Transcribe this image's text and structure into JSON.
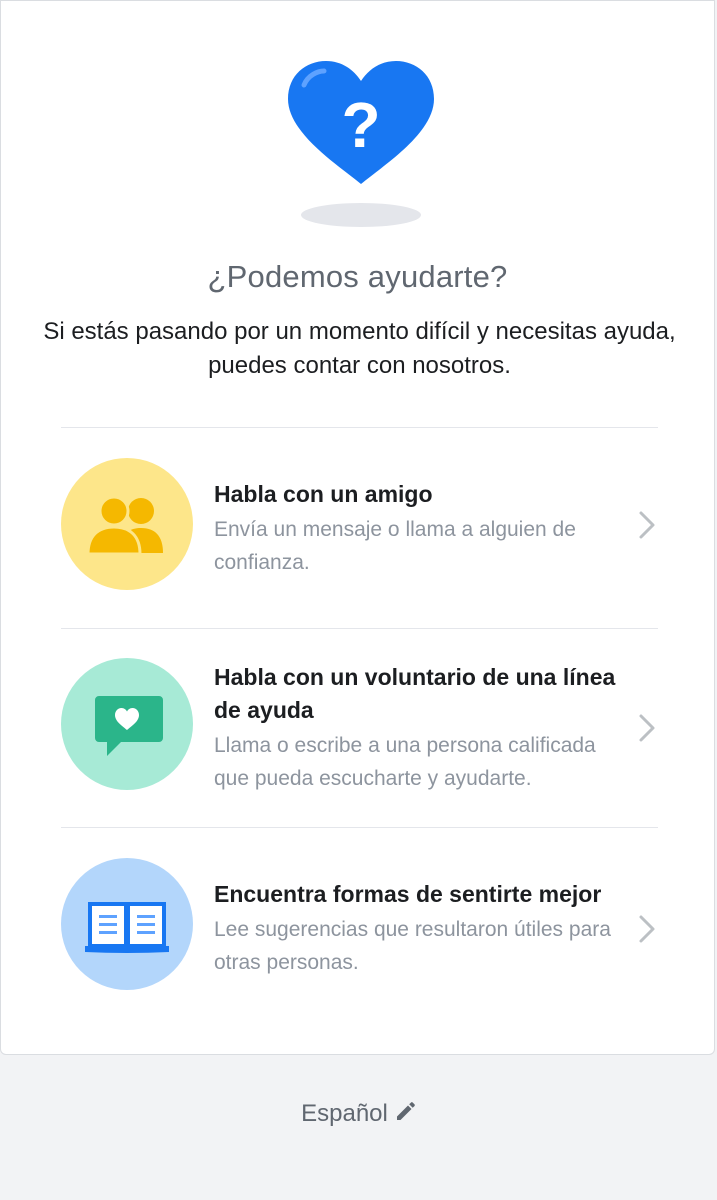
{
  "header": {
    "title": "¿Podemos ayudarte?",
    "subtitle": "Si estás pasando por un momento difícil y necesitas ayuda, puedes contar con nosotros."
  },
  "hero_icon": "heart-question-icon",
  "options": [
    {
      "title": "Habla con un amigo",
      "description": "Envía un mensaje o llama a alguien de confianza.",
      "icon": "people-icon",
      "color": "#fde68a"
    },
    {
      "title": "Habla con un voluntario de una línea de ayuda",
      "description": "Llama o escribe a una persona calificada que pueda escucharte y ayudarte.",
      "icon": "chat-heart-icon",
      "color": "#a7ead6"
    },
    {
      "title": "Encuentra formas de sentirte mejor",
      "description": "Lee sugerencias que resultaron útiles para otras personas.",
      "icon": "book-icon",
      "color": "#b3d6fb"
    }
  ],
  "footer": {
    "language": "Español",
    "edit_icon": "pencil-icon"
  },
  "colors": {
    "heart_blue": "#1877f2",
    "people_gold": "#f5b800",
    "chat_green": "#2bb58a",
    "book_blue": "#1877f2"
  }
}
